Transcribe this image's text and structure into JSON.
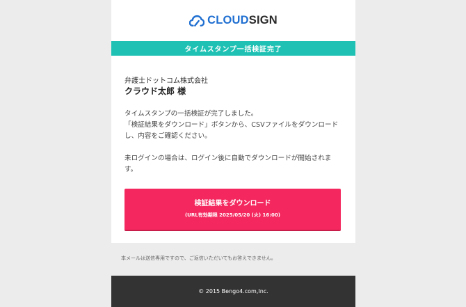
{
  "logo": {
    "icon": "cloud-logo-icon",
    "text_cloud": "CLOUD",
    "text_sign": "SIGN"
  },
  "banner": {
    "text": "タイムスタンプ一括検証完了"
  },
  "greeting": {
    "company": "弁護士ドットコム株式会社",
    "recipient": "クラウド太郎 様"
  },
  "body": {
    "line1": "タイムスタンプの一括検証が完了しました。",
    "line2": "「検証結果をダウンロード」ボタンから、CSVファイルをダウンロードし、内容をご確認ください。",
    "paragraph2": "未ログインの場合は、ログイン後に自動でダウンロードが開始されます。"
  },
  "cta": {
    "label": "検証結果をダウンロード",
    "sublabel": "(URL有効期限 2025/05/20 (火) 16:00)"
  },
  "notice": {
    "text": "本メールは送信専用ですので、ご返信いただいてもお答えできません。"
  },
  "footer": {
    "copyright": "© 2015 Bengo4.com,Inc."
  },
  "colors": {
    "page_background": "#ececec",
    "banner": "#1fc1b4",
    "button": "#f4275e",
    "footer": "#333333",
    "logo_blue": "#1f6fd1"
  }
}
